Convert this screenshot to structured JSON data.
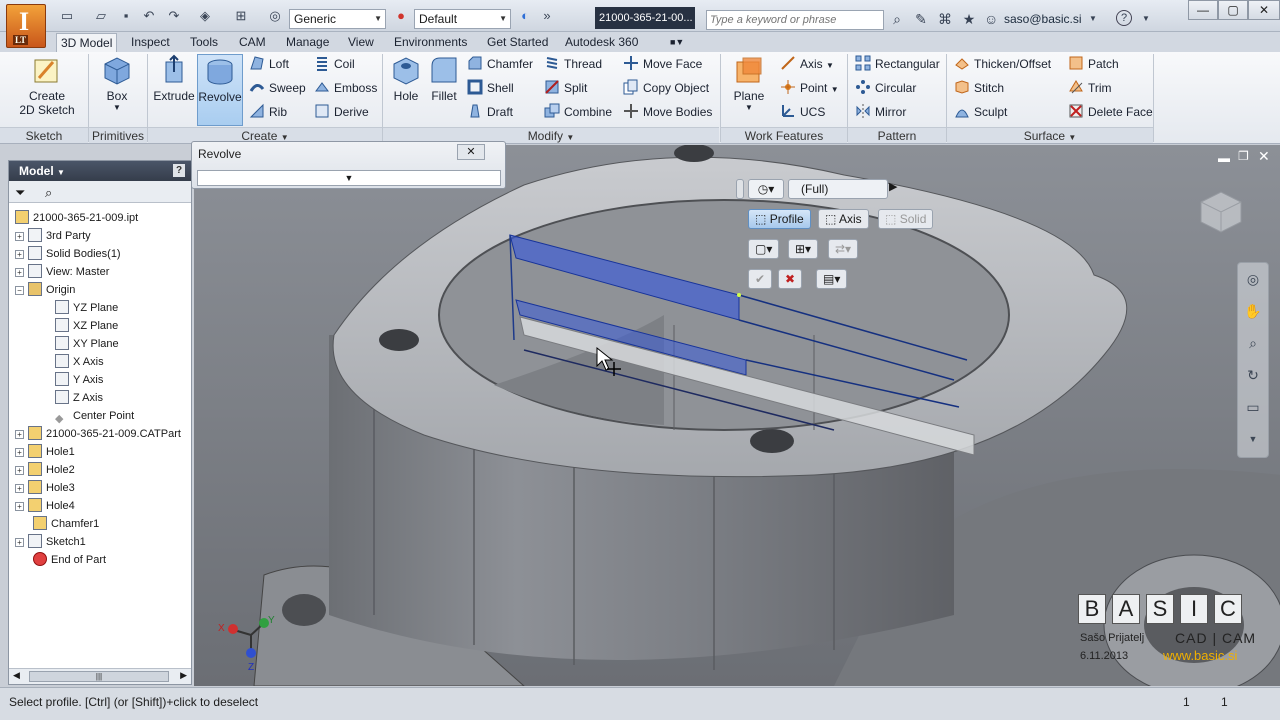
{
  "app": {
    "logo_letter": "I",
    "logo_sub": "LT",
    "material_combo": "Generic",
    "appearance_combo": "Default",
    "document_tab": "21000-365-21-00...",
    "search_placeholder": "Type a keyword or phrase",
    "user": "saso@basic.si"
  },
  "tabs": [
    "3D Model",
    "Inspect",
    "Tools",
    "CAM",
    "Manage",
    "View",
    "Environments",
    "Get Started",
    "Autodesk 360"
  ],
  "ribbon": {
    "sketch": {
      "create_2d_sketch": "Create\n2D Sketch",
      "label": "Sketch"
    },
    "primitives": {
      "box": "Box",
      "label": "Primitives"
    },
    "create": {
      "extrude": "Extrude",
      "revolve": "Revolve",
      "loft": "Loft",
      "sweep": "Sweep",
      "rib": "Rib",
      "coil": "Coil",
      "emboss": "Emboss",
      "derive": "Derive",
      "label": "Create"
    },
    "modify": {
      "hole": "Hole",
      "fillet": "Fillet",
      "chamfer": "Chamfer",
      "shell": "Shell",
      "draft": "Draft",
      "thread": "Thread",
      "split": "Split",
      "combine": "Combine",
      "move_face": "Move Face",
      "copy_object": "Copy Object",
      "move_bodies": "Move Bodies",
      "label": "Modify"
    },
    "work_features": {
      "plane": "Plane",
      "axis": "Axis",
      "point": "Point",
      "ucs": "UCS",
      "label": "Work Features"
    },
    "pattern": {
      "rectangular": "Rectangular",
      "circular": "Circular",
      "mirror": "Mirror",
      "label": "Pattern"
    },
    "surface": {
      "thicken_offset": "Thicken/Offset",
      "stitch": "Stitch",
      "sculpt": "Sculpt",
      "patch": "Patch",
      "trim": "Trim",
      "delete_face": "Delete Face",
      "label": "Surface"
    }
  },
  "browser": {
    "title": "Model",
    "items": [
      {
        "label": "21000-365-21-009.ipt"
      },
      {
        "label": "3rd Party"
      },
      {
        "label": "Solid Bodies(1)"
      },
      {
        "label": "View: Master"
      },
      {
        "label": "Origin"
      },
      {
        "label": "YZ Plane"
      },
      {
        "label": "XZ Plane"
      },
      {
        "label": "XY Plane"
      },
      {
        "label": "X Axis"
      },
      {
        "label": "Y Axis"
      },
      {
        "label": "Z Axis"
      },
      {
        "label": "Center Point"
      },
      {
        "label": "21000-365-21-009.CATPart"
      },
      {
        "label": "Hole1"
      },
      {
        "label": "Hole2"
      },
      {
        "label": "Hole3"
      },
      {
        "label": "Hole4"
      },
      {
        "label": "Chamfer1"
      },
      {
        "label": "Sketch1"
      },
      {
        "label": "End of Part"
      }
    ]
  },
  "revolve_dialog": {
    "title": "Revolve"
  },
  "mini_toolbar": {
    "extent": "(Full)",
    "profile": "Profile",
    "axis": "Axis",
    "solid": "Solid"
  },
  "watermark": {
    "letters": [
      "B",
      "A",
      "S",
      "I",
      "C"
    ],
    "cadcam": "CAD | CAM",
    "author": "Sašo Prijatelj",
    "date": "6.11.2013",
    "url": "www.basic.si"
  },
  "status": {
    "message": "Select profile. [Ctrl] (or [Shift])+click to deselect",
    "num1": "1",
    "num2": "1"
  },
  "colors": {
    "accent_blue": "#3a5bd9",
    "logo_orange": "#e07a24",
    "url_yellow": "#f0b000"
  }
}
